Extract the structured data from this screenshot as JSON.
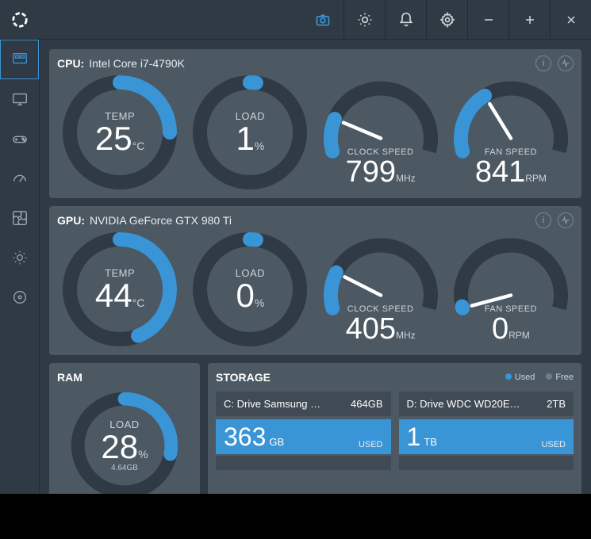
{
  "titlebar": {
    "icons": [
      "camera",
      "brightness",
      "bell",
      "settings",
      "minimize",
      "maximize",
      "close"
    ]
  },
  "sidebar": {
    "items": [
      "overview",
      "monitors",
      "gaming",
      "speed",
      "fan",
      "display",
      "disk"
    ]
  },
  "cpu": {
    "label": "CPU:",
    "name": "Intel Core i7-4790K",
    "temp_label": "TEMP",
    "temp_value": "25",
    "temp_unit": "°C",
    "temp_pct": 25,
    "load_label": "LOAD",
    "load_value": "1",
    "load_unit": "%",
    "load_pct": 1,
    "clock_label": "CLOCK SPEED",
    "clock_value": "799",
    "clock_unit": "MHz",
    "clock_pct": 18,
    "fan_label": "FAN SPEED",
    "fan_value": "841",
    "fan_unit": "RPM",
    "fan_pct": 35
  },
  "gpu": {
    "label": "GPU:",
    "name": "NVIDIA GeForce GTX 980 Ti",
    "temp_label": "TEMP",
    "temp_value": "44",
    "temp_unit": "°C",
    "temp_pct": 44,
    "load_label": "LOAD",
    "load_value": "0",
    "load_unit": "%",
    "load_pct": 0,
    "clock_label": "CLOCK SPEED",
    "clock_value": "405",
    "clock_unit": "MHz",
    "clock_pct": 20,
    "fan_label": "FAN SPEED",
    "fan_value": "0",
    "fan_unit": "RPM",
    "fan_pct": 0
  },
  "ram": {
    "label": "RAM",
    "load_label": "LOAD",
    "load_value": "28",
    "load_unit": "%",
    "load_pct": 28,
    "sub": "4.64GB"
  },
  "storage": {
    "label": "STORAGE",
    "legend_used": "Used",
    "legend_free": "Free",
    "color_used": "#3a95d6",
    "color_free": "#6f7d88",
    "drives": [
      {
        "title": "C: Drive Samsung …",
        "total": "464GB",
        "used_num": "363",
        "used_unit": "GB",
        "tag": "USED"
      },
      {
        "title": "D: Drive WDC WD20E…",
        "total": "2TB",
        "used_num": "1",
        "used_unit": "TB",
        "tag": "USED"
      }
    ]
  },
  "chart_data": [
    {
      "type": "gauge",
      "title": "CPU TEMP",
      "value": 25,
      "unit": "°C",
      "range": [
        0,
        100
      ]
    },
    {
      "type": "gauge",
      "title": "CPU LOAD",
      "value": 1,
      "unit": "%",
      "range": [
        0,
        100
      ]
    },
    {
      "type": "gauge",
      "title": "CPU CLOCK SPEED",
      "value": 799,
      "unit": "MHz",
      "range": [
        0,
        4500
      ]
    },
    {
      "type": "gauge",
      "title": "CPU FAN SPEED",
      "value": 841,
      "unit": "RPM",
      "range": [
        0,
        2500
      ]
    },
    {
      "type": "gauge",
      "title": "GPU TEMP",
      "value": 44,
      "unit": "°C",
      "range": [
        0,
        100
      ]
    },
    {
      "type": "gauge",
      "title": "GPU LOAD",
      "value": 0,
      "unit": "%",
      "range": [
        0,
        100
      ]
    },
    {
      "type": "gauge",
      "title": "GPU CLOCK SPEED",
      "value": 405,
      "unit": "MHz",
      "range": [
        0,
        2000
      ]
    },
    {
      "type": "gauge",
      "title": "GPU FAN SPEED",
      "value": 0,
      "unit": "RPM",
      "range": [
        0,
        3000
      ]
    },
    {
      "type": "gauge",
      "title": "RAM LOAD",
      "value": 28,
      "unit": "%",
      "range": [
        0,
        100
      ]
    }
  ]
}
